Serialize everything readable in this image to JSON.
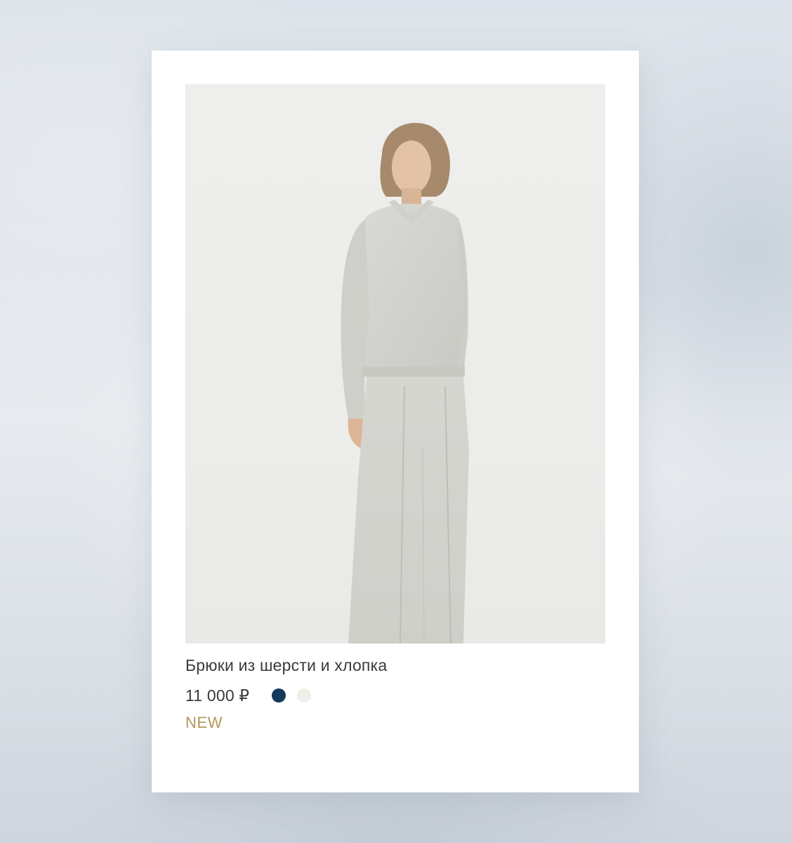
{
  "product": {
    "name": "Брюки из шерсти и хлопка",
    "price": "11 000 ₽",
    "badge": "NEW",
    "badge_color": "#b4975a",
    "colors": [
      {
        "name": "navy",
        "hex": "#163a5c"
      },
      {
        "name": "ivory",
        "hex": "#efefea"
      }
    ]
  }
}
